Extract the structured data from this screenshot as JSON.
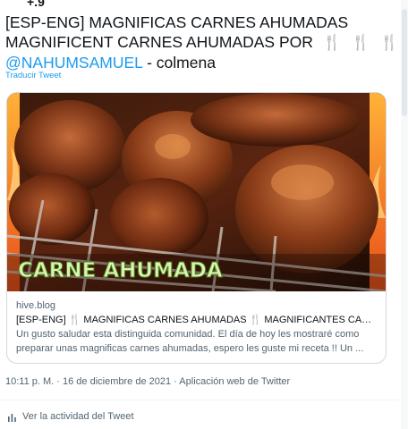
{
  "header": {
    "clipped_text": "+.9"
  },
  "tweet": {
    "line1": "[ESP-ENG] MAGNIFICAS CARNES AHUMADAS",
    "line2": "MAGNIFICENT CARNES AHUMADAS   POR",
    "mention": "@NAHUMSAMUEL",
    "suffix": " - colmena",
    "fork_icon_glyph": "🍴",
    "translate_label": "Traducir Tweet"
  },
  "card": {
    "image_overlay_text": "CARNE AHUMADA",
    "domain": "hive.blog",
    "title": "[ESP-ENG] 🍴 MAGNIFICAS CARNES AHUMADAS 🍴 MAGNIFICANTES CARN...",
    "desc_line1": "Un gusto saludar esta distinguida comunidad. El día de hoy les mostraré como",
    "desc_line2": "preparar unas magnificas carnes ahumadas, espero les guste mi receta !! Un ..."
  },
  "meta": {
    "time": "10:11 p. M.",
    "separator": "·",
    "date": "16 de diciembre de 2021",
    "source": "Aplicación web de Twitter"
  },
  "activity": {
    "label": "Ver la actividad del Tweet",
    "icon": "bar-chart-icon"
  },
  "colors": {
    "link": "#1d9bf0",
    "text": "#0f1419",
    "secondary": "#536471",
    "border": "#cfd9de",
    "overlay_text": "#d6f5b0"
  }
}
